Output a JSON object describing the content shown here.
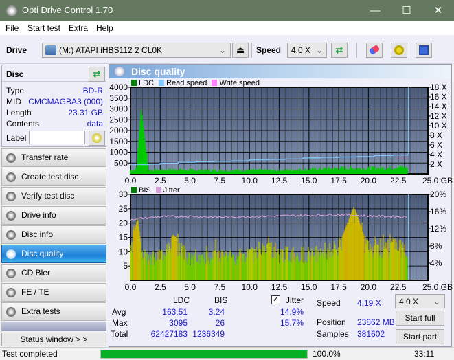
{
  "window": {
    "title": "Opti Drive Control 1.70",
    "minimize": "—",
    "maximize": "☐",
    "close": "✕"
  },
  "menu": [
    "File",
    "Start test",
    "Extra",
    "Help"
  ],
  "toolbar": {
    "drive_label": "Drive",
    "drive_value": "(M:)  ATAPI iHBS112  2 CL0K",
    "speed_label": "Speed",
    "speed_value": "4.0 X",
    "eject_icon": "⏏",
    "refresh_icon": "⇄",
    "erase_icon": "eraser",
    "settings_icon": "gear",
    "save_icon": "💾"
  },
  "disc": {
    "title": "Disc",
    "fields": [
      {
        "key": "Type",
        "value": "BD-R"
      },
      {
        "key": "MID",
        "value": "CMCMAGBA3 (000)"
      },
      {
        "key": "Length",
        "value": "23.31 GB"
      },
      {
        "key": "Contents",
        "value": "data"
      }
    ],
    "label_key": "Label",
    "label_value": ""
  },
  "nav": [
    {
      "label": "Transfer rate",
      "active": false
    },
    {
      "label": "Create test disc",
      "active": false
    },
    {
      "label": "Verify test disc",
      "active": false
    },
    {
      "label": "Drive info",
      "active": false
    },
    {
      "label": "Disc info",
      "active": false
    },
    {
      "label": "Disc quality",
      "active": true
    },
    {
      "label": "CD Bler",
      "active": false
    },
    {
      "label": "FE / TE",
      "active": false
    },
    {
      "label": "Extra tests",
      "active": false
    }
  ],
  "status_window_label": "Status window > >",
  "panel": {
    "title": "Disc quality"
  },
  "colors": {
    "ldc": "#00c800",
    "read": "#80c8ff",
    "write": "#ff80ff",
    "bis": "#008000",
    "jitter": "#d8a0d8",
    "plot_bg_top": "#4a5a7a",
    "plot_bg_bottom": "#7e8eae",
    "progress": "#06b025"
  },
  "chart_data": [
    {
      "type": "area",
      "legend": [
        "LDC",
        "Read speed",
        "Write speed"
      ],
      "xlabel": "GB",
      "x_ticks": [
        "0.0",
        "2.5",
        "5.0",
        "7.5",
        "10.0",
        "12.5",
        "15.0",
        "17.5",
        "20.0",
        "22.5",
        "25.0 GB"
      ],
      "xlim": [
        0,
        25
      ],
      "y_left_ticks": [
        "500",
        "1000",
        "1500",
        "2000",
        "2500",
        "3000",
        "3500",
        "4000"
      ],
      "ylim_left": [
        0,
        4000
      ],
      "y_right_ticks": [
        "2 X",
        "4 X",
        "6 X",
        "8 X",
        "10 X",
        "12 X",
        "14 X",
        "16 X",
        "18 X"
      ],
      "ylim_right": [
        0,
        18
      ],
      "series": [
        {
          "name": "LDC",
          "x": [
            0,
            0.5,
            0.9,
            1.5,
            2.5,
            4,
            5,
            7.5,
            10,
            12.5,
            14,
            15,
            17,
            18,
            20,
            21.5,
            22.5,
            23.31
          ],
          "values": [
            150,
            180,
            3095,
            160,
            170,
            190,
            160,
            150,
            160,
            150,
            180,
            200,
            230,
            250,
            240,
            260,
            300,
            280
          ]
        },
        {
          "name": "Read speed",
          "x": [
            0,
            1.5,
            2.5,
            4,
            5.5,
            7,
            8.5,
            10,
            11.5,
            13,
            14.5,
            16,
            17.5,
            19,
            20.5,
            22,
            23.31
          ],
          "values": [
            1.9,
            2.0,
            2.2,
            2.4,
            2.5,
            2.6,
            2.7,
            2.9,
            3.0,
            3.1,
            3.3,
            3.4,
            3.5,
            3.6,
            3.8,
            3.9,
            4.2
          ]
        }
      ]
    },
    {
      "type": "bar",
      "legend": [
        "BIS",
        "Jitter"
      ],
      "xlabel": "GB",
      "x_ticks": [
        "0.0",
        "2.5",
        "5.0",
        "7.5",
        "10.0",
        "12.5",
        "15.0",
        "17.5",
        "20.0",
        "22.5",
        "25.0 GB"
      ],
      "xlim": [
        0,
        25
      ],
      "y_left_ticks": [
        "5",
        "10",
        "15",
        "20",
        "25",
        "30"
      ],
      "ylim_left": [
        0,
        30
      ],
      "y_right_ticks": [
        "4%",
        "8%",
        "12%",
        "16%",
        "20%"
      ],
      "ylim_right": [
        0,
        20
      ],
      "series": [
        {
          "name": "BIS",
          "x": [
            0,
            0.6,
            1,
            2.5,
            3.6,
            5,
            7.5,
            10,
            11.5,
            12.5,
            15,
            17.5,
            18.8,
            20,
            22,
            23.31
          ],
          "values": [
            11,
            22,
            9,
            9,
            16,
            8,
            9,
            9,
            14,
            10,
            10,
            12,
            26,
            11,
            13,
            11
          ]
        },
        {
          "name": "Jitter",
          "x": [
            0,
            2.5,
            5,
            7.5,
            10,
            12.5,
            15,
            17.5,
            20,
            22.5,
            23.31
          ],
          "values": [
            14.2,
            14.8,
            14.9,
            14.7,
            14.8,
            15.0,
            15.1,
            15.3,
            15.0,
            14.8,
            14.7
          ]
        }
      ]
    }
  ],
  "stats": {
    "headers": [
      "LDC",
      "BIS"
    ],
    "rows": [
      {
        "label": "Avg",
        "ldc": "163.51",
        "bis": "3.24",
        "jitter": "14.9%"
      },
      {
        "label": "Max",
        "ldc": "3095",
        "bis": "26",
        "jitter": "15.7%"
      },
      {
        "label": "Total",
        "ldc": "62427183",
        "bis": "1236349",
        "jitter": ""
      }
    ],
    "jitter_label": "Jitter",
    "jitter_checked": true,
    "speed_label": "Speed",
    "speed_value": "4.19 X",
    "position_label": "Position",
    "position_value": "23862 MB",
    "samples_label": "Samples",
    "samples_value": "381602",
    "speed_select": "4.0 X",
    "start_full": "Start full",
    "start_part": "Start part"
  },
  "statusbar": {
    "text": "Test completed",
    "progress": 100.0,
    "progress_text": "100.0%",
    "time": "33:11"
  }
}
